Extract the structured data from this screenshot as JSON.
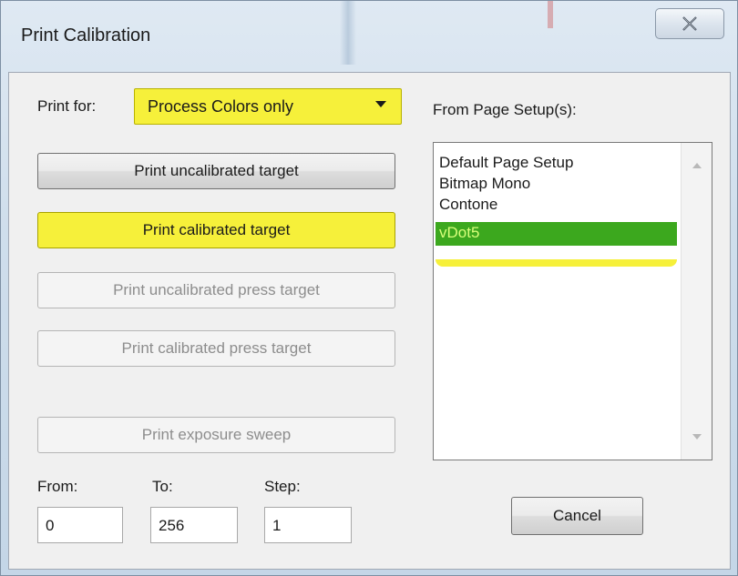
{
  "window": {
    "title": "Print Calibration",
    "close_icon": "close-icon"
  },
  "print_for": {
    "label": "Print for:",
    "value": "Process Colors only",
    "highlight_color": "#f6f03a"
  },
  "buttons": {
    "print_uncalibrated_target": "Print uncalibrated target",
    "print_calibrated_target": "Print calibrated target",
    "print_uncalibrated_press_target": "Print uncalibrated press target",
    "print_calibrated_press_target": "Print calibrated press target",
    "print_exposure_sweep": "Print exposure sweep",
    "cancel": "Cancel"
  },
  "page_setups": {
    "label": "From Page Setup(s):",
    "items": [
      "Default Page Setup",
      "Bitmap Mono",
      "Contone",
      "vDot5"
    ],
    "selected": "vDot5",
    "selected_color": "#3ca81e"
  },
  "sweep": {
    "from_label": "From:",
    "to_label": "To:",
    "step_label": "Step:",
    "from_value": "0",
    "to_value": "256",
    "step_value": "1"
  }
}
